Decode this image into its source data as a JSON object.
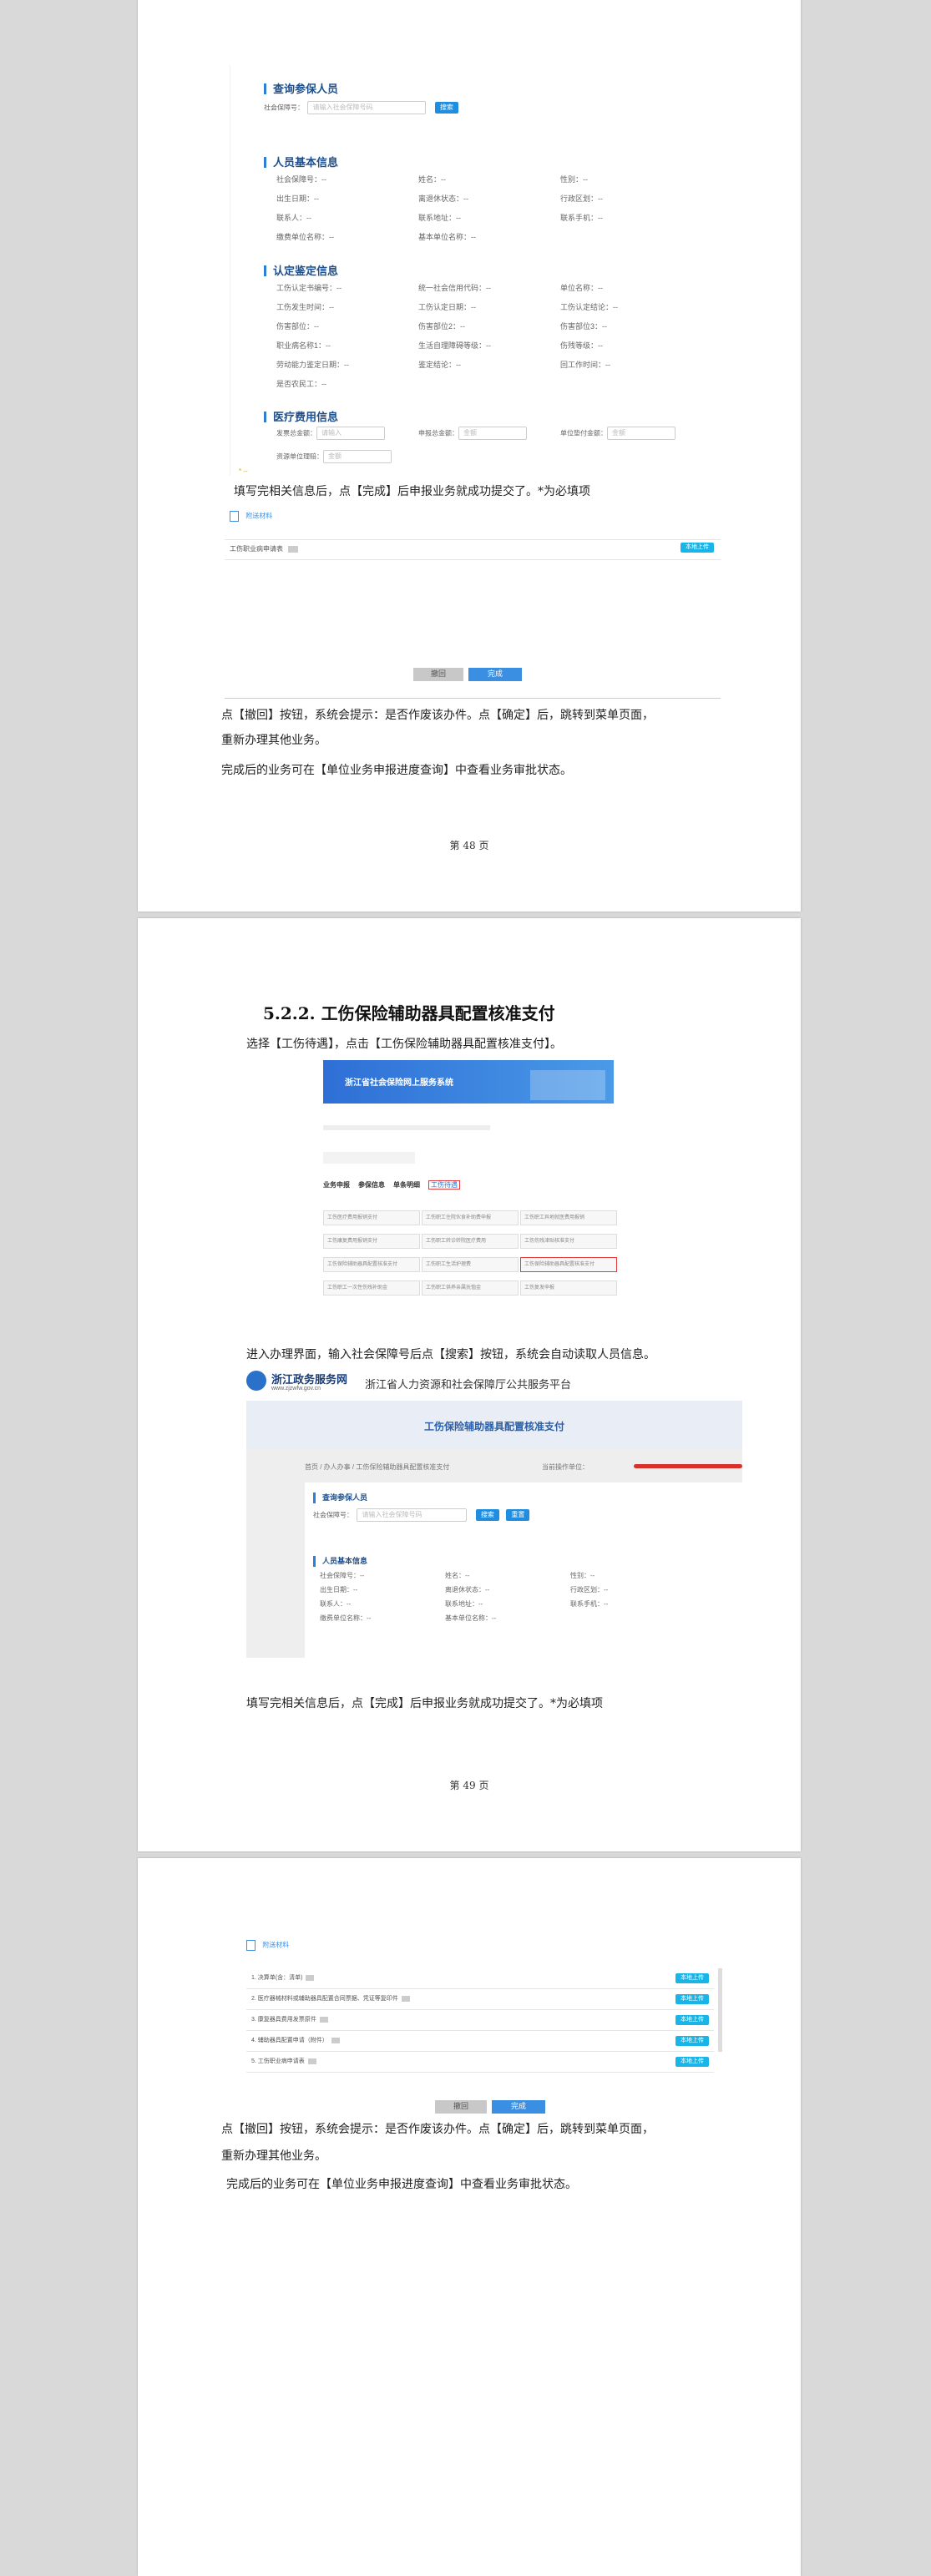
{
  "page1": {
    "screenshot": {
      "query_title": "查询参保人员",
      "ssn_label": "社会保障号：",
      "ssn_placeholder": "请输入社会保障号码",
      "search_button": "搜索",
      "basic_title": "人员基本信息",
      "basic_fields": [
        "社会保障号：--",
        "姓名：--",
        "性别：--",
        "出生日期：--",
        "离退休状态：--",
        "行政区划：--",
        "联系人：--",
        "联系地址：--",
        "联系手机：--",
        "缴费单位名称：--",
        "基本单位名称：--"
      ],
      "injury_title": "认定鉴定信息",
      "injury_fields": [
        "工伤认定书编号：--",
        "统一社会信用代码：--",
        "单位名称：--",
        "工伤发生时间：--",
        "工伤认定日期：--",
        "工伤认定结论：--",
        "伤害部位：--",
        "伤害部位2：--",
        "伤害部位3：--",
        "职业病名称1：--",
        "生活自理障碍等级：--",
        "伤残等级：--",
        "劳动能力鉴定日期：--",
        "鉴定结论：--",
        "回工作时间：--",
        "是否农民工：--"
      ],
      "medical_title": "医疗费用信息",
      "medical_fields": [
        {
          "label": "发票总金额：",
          "placeholder": "请输入"
        },
        {
          "label": "申报总金额：",
          "placeholder": "金额"
        },
        {
          "label": "单位垫付金额：",
          "placeholder": "金额"
        },
        {
          "label": "资源单位理赔：",
          "placeholder": "金额"
        }
      ]
    },
    "text_fill": "填写完相关信息后，点【完成】后申报业务就成功提交了。*为必填项",
    "materials_link": "附送材料",
    "material_row": "工伤职业病申请表",
    "upload_button": "本地上传",
    "withdraw_button": "撤回",
    "finish_button": "完成",
    "text_withdraw_1": "点【撤回】按钮，系统会提示：是否作废该办件。点【确定】后，跳转到菜单页面，",
    "text_withdraw_2": "重新办理其他业务。",
    "text_status": "完成后的业务可在【单位业务申报进度查询】中查看业务审批状态。",
    "page_number": "第  48  页"
  },
  "page2": {
    "heading": "5.2.2.  工伤保险辅助器具配置核准支付",
    "text_select": "选择【工伤待遇】，点击【工伤保险辅助器具配置核准支付】。",
    "portal_banner": "浙江省社会保险网上服务系统",
    "portal_tabs": [
      "业务申报",
      "参保信息",
      "单条明细",
      "工伤待遇"
    ],
    "portal_tiles": [
      "工伤医疗费用报销支付",
      "工伤职工住院伙食补助费申报",
      "工伤职工异地就医费用报销",
      "工伤康复费用报销支付",
      "工伤职工转诊转院医疗费用",
      "工伤伤残津贴核准支付",
      "工伤保险辅助器具配置核准支付",
      "工伤职工生活护理费",
      "工伤保险辅助器具配置核准支付",
      "工伤职工一次性伤残补助金",
      "工伤职工供养亲属抚恤金",
      "工伤复发申报"
    ],
    "text_enter": "进入办理界面，输入社会保障号后点【搜索】按钮，系统会自动读取人员信息。",
    "gov_logo_name": "浙江政务服务网",
    "gov_logo_url": "www.zjzwfw.gov.cn",
    "gov_platform": "浙江省人力资源和社会保障厅公共服务平台",
    "form_title": "工伤保险辅助器具配置核准支付",
    "breadcrumb": "首页 / 办人办事 / 工伤保险辅助器具配置核准支付",
    "unit_label": "当前操作单位：",
    "query_title": "查询参保人员",
    "ssn_label": "社会保障号：",
    "ssn_placeholder": "请输入社会保障号码",
    "search_button": "搜索",
    "reset_button": "重置",
    "basic_title": "人员基本信息",
    "basic_fields": [
      "社会保障号：--",
      "姓名：--",
      "性别：--",
      "出生日期：--",
      "离退休状态：--",
      "行政区划：--",
      "联系人：--",
      "联系地址：--",
      "联系手机：--",
      "缴费单位名称：--",
      "基本单位名称：--"
    ],
    "text_fill": "填写完相关信息后，点【完成】后申报业务就成功提交了。*为必填项",
    "page_number": "第  49  页"
  },
  "page3": {
    "materials_link": "附送材料",
    "material_rows": [
      "1. 决算单(含：清单)",
      "2. 医疗器械材料或辅助器具配置合同票据、凭证等复印件",
      "3. 康复器具费用发票原件",
      "4. 辅助器具配置申请（附件）",
      "5. 工伤职业病申请表"
    ],
    "upload_button": "本地上传",
    "withdraw_button": "撤回",
    "finish_button": "完成",
    "text_withdraw_1": "点【撤回】按钮，系统会提示：是否作废该办件。点【确定】后，跳转到菜单页面，",
    "text_withdraw_2": "重新办理其他业务。",
    "text_status": "完成后的业务可在【单位业务申报进度查询】中查看业务审批状态。"
  },
  "colors": {
    "accent": "#1f8ee0",
    "upload": "#19b4e8",
    "banner": "#3b82e0",
    "page_bg": "#d9d9d9"
  }
}
